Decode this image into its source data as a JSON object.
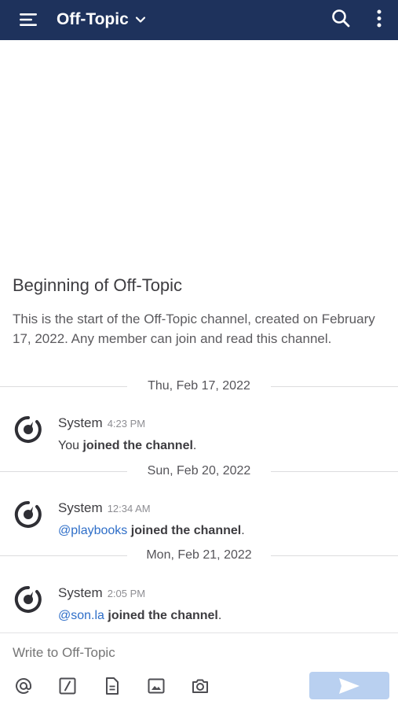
{
  "header": {
    "channel_name": "Off-Topic"
  },
  "intro": {
    "title": "Beginning of Off-Topic",
    "text": "This is the start of the Off-Topic channel, created on February 17, 2022.  Any member can join and read this channel."
  },
  "separators": [
    {
      "label": "Thu, Feb 17, 2022"
    },
    {
      "label": "Sun, Feb 20, 2022"
    },
    {
      "label": "Mon, Feb 21, 2022"
    }
  ],
  "posts": [
    {
      "author": "System",
      "time": "4:23 PM",
      "mention": "",
      "prefix": "You",
      "action": "joined the channel",
      "suffix": "."
    },
    {
      "author": "System",
      "time": "12:34 AM",
      "mention": "@playbooks",
      "prefix": "",
      "action": "joined the channel",
      "suffix": "."
    },
    {
      "author": "System",
      "time": "2:05 PM",
      "mention": "@son.la",
      "prefix": "",
      "action": "joined the channel",
      "suffix": "."
    }
  ],
  "composer": {
    "placeholder": "Write to Off-Topic"
  },
  "icons": {
    "menu": "hamburger-icon",
    "dropdown": "chevron-down-icon",
    "search": "search-icon",
    "more": "more-vertical-icon",
    "avatar": "system-avatar-icon",
    "at": "at-mention-icon",
    "slash": "slash-command-icon",
    "file": "file-attach-icon",
    "image": "image-icon",
    "camera": "camera-icon",
    "send": "send-icon"
  },
  "colors": {
    "header": "#1e325c",
    "mention": "#2e6ec8",
    "send_disabled": "#b9d0f0"
  }
}
